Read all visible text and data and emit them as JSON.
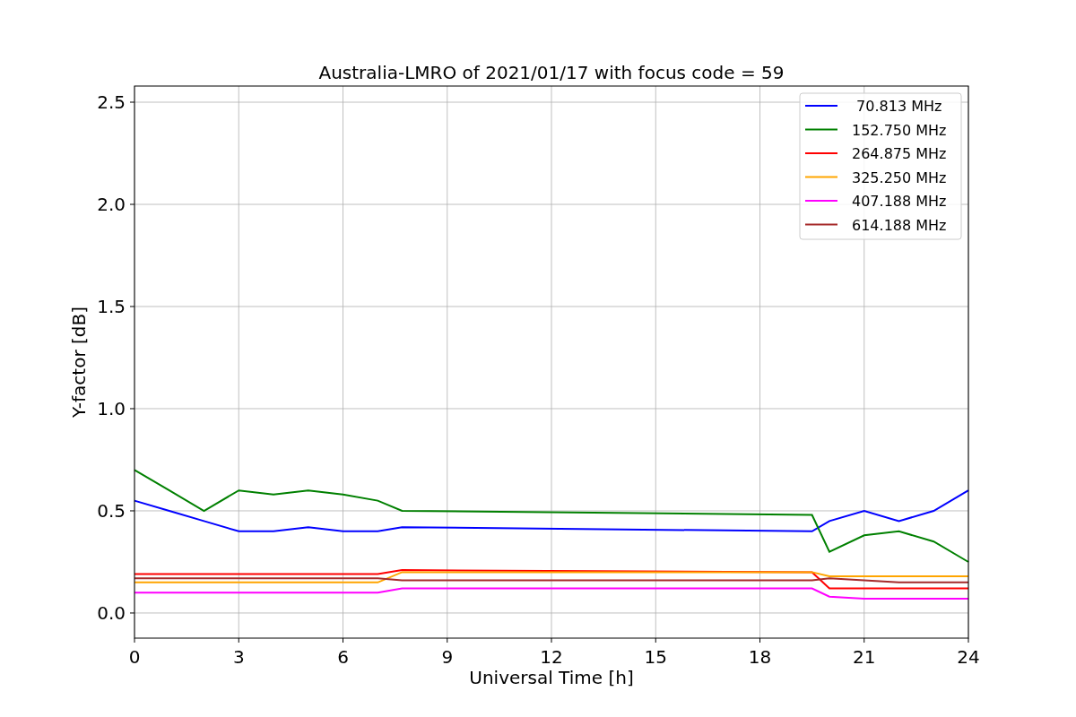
{
  "chart_data": {
    "type": "line",
    "title": "Australia-LMRO of 2021/01/17 with focus code = 59",
    "xlabel": "Universal Time [h]",
    "ylabel": "Y-factor [dB]",
    "x": [
      0,
      1,
      2,
      3,
      4,
      5,
      6,
      7,
      7.7,
      19.5,
      20,
      21,
      22,
      23,
      24
    ],
    "series": [
      {
        "name": " 70.813 MHz",
        "color": "#0000ff",
        "values": [
          0.55,
          0.5,
          0.45,
          0.4,
          0.4,
          0.42,
          0.4,
          0.4,
          0.42,
          0.4,
          0.45,
          0.5,
          0.45,
          0.5,
          0.6
        ]
      },
      {
        "name": "152.750 MHz",
        "color": "#008000",
        "values": [
          0.7,
          0.6,
          0.5,
          0.6,
          0.58,
          0.6,
          0.58,
          0.55,
          0.5,
          0.48,
          0.3,
          0.38,
          0.4,
          0.35,
          0.25
        ]
      },
      {
        "name": "264.875 MHz",
        "color": "#ff0000",
        "values": [
          0.19,
          0.19,
          0.19,
          0.19,
          0.19,
          0.19,
          0.19,
          0.19,
          0.21,
          0.2,
          0.12,
          0.12,
          0.12,
          0.12,
          0.12
        ]
      },
      {
        "name": "325.250 MHz",
        "color": "#ffa500",
        "values": [
          0.15,
          0.15,
          0.15,
          0.15,
          0.15,
          0.15,
          0.15,
          0.15,
          0.2,
          0.2,
          0.18,
          0.18,
          0.18,
          0.18,
          0.18
        ]
      },
      {
        "name": "407.188 MHz",
        "color": "#ff00ff",
        "values": [
          0.1,
          0.1,
          0.1,
          0.1,
          0.1,
          0.1,
          0.1,
          0.1,
          0.12,
          0.12,
          0.08,
          0.07,
          0.07,
          0.07,
          0.07
        ]
      },
      {
        "name": "614.188 MHz",
        "color": "#a52a2a",
        "values": [
          0.17,
          0.17,
          0.17,
          0.17,
          0.17,
          0.17,
          0.17,
          0.17,
          0.16,
          0.16,
          0.17,
          0.16,
          0.15,
          0.15,
          0.15
        ]
      }
    ],
    "grid": true,
    "legend": true,
    "xlim": [
      0,
      24
    ],
    "ylim": [
      -0.123,
      2.579
    ],
    "xticks": [
      0,
      3,
      6,
      9,
      12,
      15,
      18,
      21,
      24
    ],
    "yticks": [
      {
        "value": 0,
        "label": "0.0"
      },
      {
        "value": 0.5,
        "label": "0.5"
      },
      {
        "value": 1,
        "label": "1.0"
      },
      {
        "value": 1.5,
        "label": "1.5"
      },
      {
        "value": 2,
        "label": "2.0"
      },
      {
        "value": 2.5,
        "label": "2.5"
      }
    ]
  }
}
